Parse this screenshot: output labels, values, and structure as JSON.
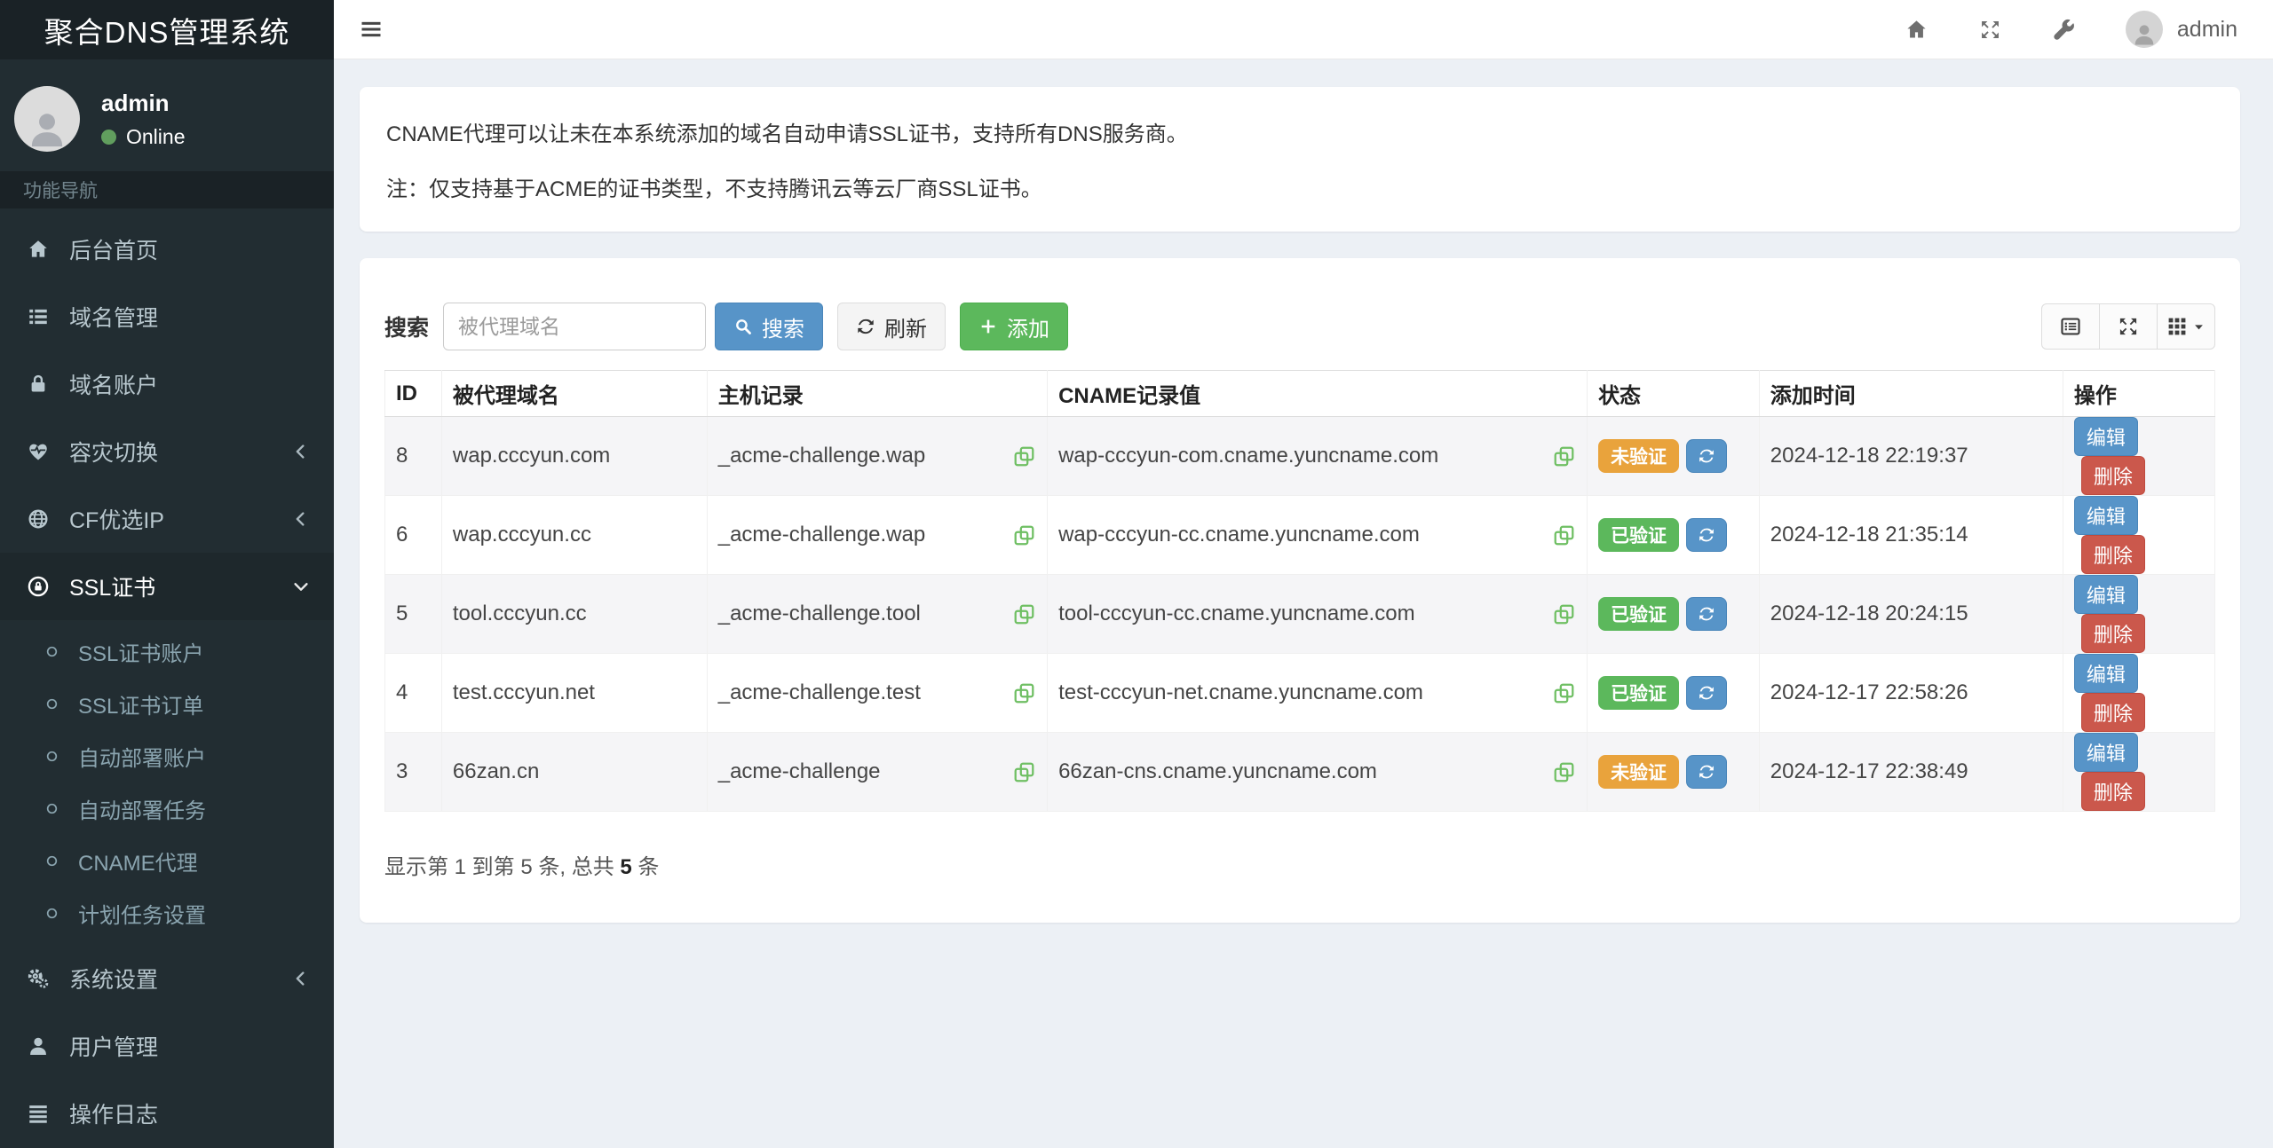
{
  "app": {
    "title": "聚合DNS管理系统"
  },
  "topbar": {
    "username": "admin",
    "icons": [
      "home-icon",
      "fullscreen-icon",
      "wrench-icon"
    ]
  },
  "user_panel": {
    "name": "admin",
    "status": "Online",
    "status_color": "#619e5e"
  },
  "sidebar": {
    "section_header": "功能导航",
    "items": [
      {
        "label": "后台首页",
        "icon": "home-icon"
      },
      {
        "label": "域名管理",
        "icon": "list-icon"
      },
      {
        "label": "域名账户",
        "icon": "lock-icon"
      },
      {
        "label": "容灾切换",
        "icon": "heartbeat-icon",
        "chevron": "left"
      },
      {
        "label": "CF优选IP",
        "icon": "globe-icon",
        "chevron": "left"
      },
      {
        "label": "SSL证书",
        "icon": "ssl-lock-icon",
        "chevron": "down",
        "active": true,
        "children": [
          "SSL证书账户",
          "SSL证书订单",
          "自动部署账户",
          "自动部署任务",
          "CNAME代理",
          "计划任务设置"
        ]
      },
      {
        "label": "系统设置",
        "icon": "gears-icon",
        "chevron": "left"
      },
      {
        "label": "用户管理",
        "icon": "user-icon"
      },
      {
        "label": "操作日志",
        "icon": "log-icon"
      }
    ]
  },
  "info_card": {
    "line1": "CNAME代理可以让未在本系统添加的域名自动申请SSL证书，支持所有DNS服务商。",
    "line2": "注：仅支持基于ACME的证书类型，不支持腾讯云等云厂商SSL证书。"
  },
  "toolbar": {
    "search_label": "搜索",
    "search_placeholder": "被代理域名",
    "search_value": "",
    "search_button": "搜索",
    "refresh_button": "刷新",
    "add_button": "添加",
    "view_buttons": [
      "detail-view-icon",
      "fullscreen-icon",
      "columns-grid-icon"
    ]
  },
  "table": {
    "columns": [
      "ID",
      "被代理域名",
      "主机记录",
      "CNAME记录值",
      "状态",
      "添加时间",
      "操作"
    ],
    "rows": [
      {
        "id": "8",
        "domain": "wap.cccyun.com",
        "host": "_acme-challenge.wap",
        "cname": "wap-cccyun-com.cname.yuncname.com",
        "status": "未验证",
        "status_type": "warning",
        "time": "2024-12-18 22:19:37"
      },
      {
        "id": "6",
        "domain": "wap.cccyun.cc",
        "host": "_acme-challenge.wap",
        "cname": "wap-cccyun-cc.cname.yuncname.com",
        "status": "已验证",
        "status_type": "success",
        "time": "2024-12-18 21:35:14"
      },
      {
        "id": "5",
        "domain": "tool.cccyun.cc",
        "host": "_acme-challenge.tool",
        "cname": "tool-cccyun-cc.cname.yuncname.com",
        "status": "已验证",
        "status_type": "success",
        "time": "2024-12-18 20:24:15"
      },
      {
        "id": "4",
        "domain": "test.cccyun.net",
        "host": "_acme-challenge.test",
        "cname": "test-cccyun-net.cname.yuncname.com",
        "status": "已验证",
        "status_type": "success",
        "time": "2024-12-17 22:58:26"
      },
      {
        "id": "3",
        "domain": "66zan.cn",
        "host": "_acme-challenge",
        "cname": "66zan-cns.cname.yuncname.com",
        "status": "未验证",
        "status_type": "warning",
        "time": "2024-12-17 22:38:49"
      }
    ],
    "actions": {
      "edit": "编辑",
      "delete": "删除"
    },
    "summary": {
      "prefix": "显示第 1 到第 5 条, 总共 ",
      "total": "5",
      "suffix": " 条"
    }
  },
  "colors": {
    "sidebar_bg": "#222d32",
    "sidebar_dark": "#1a2226",
    "accent_blue": "#5794c8",
    "success_green": "#5cb85c",
    "warning_orange": "#e9a33c",
    "danger_red": "#cb584c",
    "content_bg": "#ecf0f5"
  }
}
